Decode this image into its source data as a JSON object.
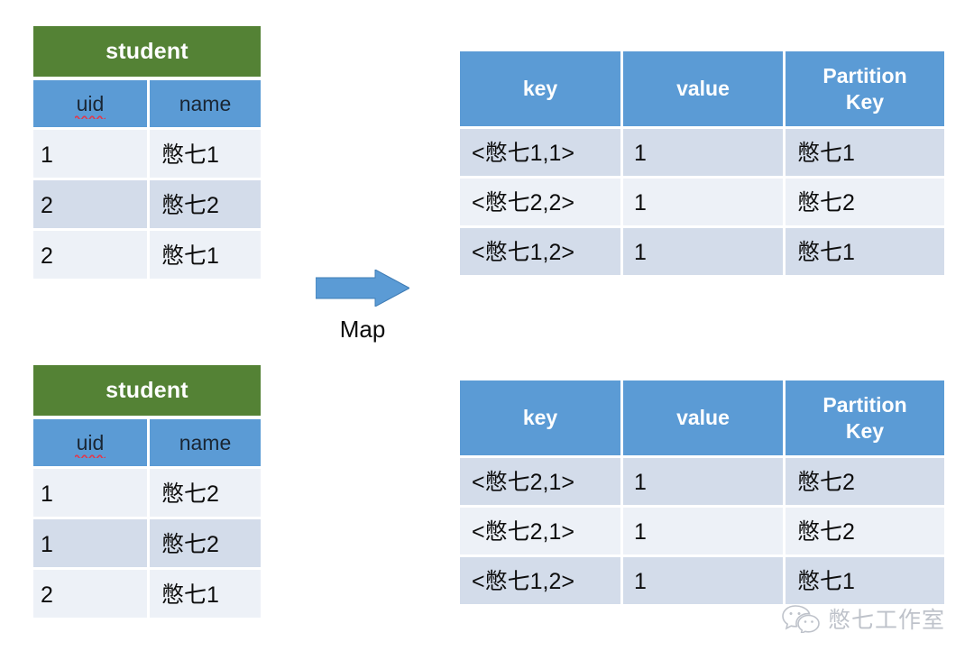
{
  "diagram": {
    "title_bar_color": "#548235",
    "header_color": "#5B9BD5",
    "stripe_dark": "#D3DCEA",
    "stripe_light": "#EDF1F7",
    "arrow_color": "#5B9BD5"
  },
  "transform": {
    "arrow_icon": "right-arrow-icon",
    "label": "Map"
  },
  "student_tables": [
    {
      "title": "student",
      "columns": [
        "uid",
        "name"
      ],
      "uid_has_spellcheck_underline": true,
      "rows": [
        [
          "1",
          "憋七1"
        ],
        [
          "2",
          "憋七2"
        ],
        [
          "2",
          "憋七1"
        ]
      ]
    },
    {
      "title": "student",
      "columns": [
        "uid",
        "name"
      ],
      "uid_has_spellcheck_underline": true,
      "rows": [
        [
          "1",
          "憋七2"
        ],
        [
          "1",
          "憋七2"
        ],
        [
          "2",
          "憋七1"
        ]
      ]
    }
  ],
  "kv_tables": [
    {
      "columns": [
        "key",
        "value",
        "Partition Key"
      ],
      "column_lines": [
        [
          "key"
        ],
        [
          "value"
        ],
        [
          "Partition",
          "Key"
        ]
      ],
      "rows": [
        [
          "<憋七1,1>",
          "1",
          "憋七1"
        ],
        [
          "<憋七2,2>",
          "1",
          "憋七2"
        ],
        [
          "<憋七1,2>",
          "1",
          "憋七1"
        ]
      ]
    },
    {
      "columns": [
        "key",
        "value",
        "Partition Key"
      ],
      "column_lines": [
        [
          "key"
        ],
        [
          "value"
        ],
        [
          "Partition",
          "Key"
        ]
      ],
      "rows": [
        [
          "<憋七2,1>",
          "1",
          "憋七2"
        ],
        [
          "<憋七2,1>",
          "1",
          "憋七2"
        ],
        [
          "<憋七1,2>",
          "1",
          "憋七1"
        ]
      ]
    }
  ],
  "watermark": {
    "icon": "wechat-icon",
    "text": "憋七工作室"
  }
}
